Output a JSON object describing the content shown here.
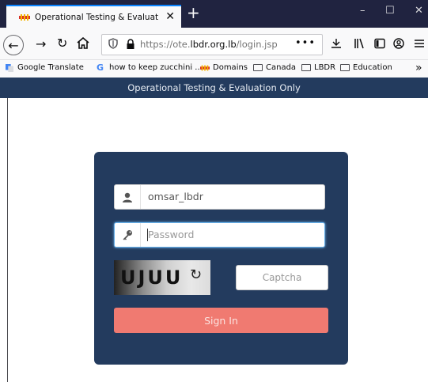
{
  "browser": {
    "tab": {
      "title": "Operational Testing & Evaluatic",
      "close": "✕"
    },
    "new_tab": "+",
    "window_controls": {
      "minimize": "–",
      "maximize": "☐",
      "close": "✕"
    },
    "url": {
      "prefix": "https://ote.",
      "domain": "lbdr.org.lb",
      "path": "/login.jsp"
    },
    "more": "•••",
    "bookmarks": [
      {
        "label": "Google Translate",
        "icon": "google-translate-icon"
      },
      {
        "label": "how to keep zucchini ...",
        "icon": "google-icon"
      },
      {
        "label": "Domains",
        "icon": "domains-favicon"
      },
      {
        "label": "Canada",
        "icon": "folder-icon"
      },
      {
        "label": "LBDR",
        "icon": "folder-icon"
      },
      {
        "label": "Education",
        "icon": "folder-icon"
      }
    ],
    "overflow": "»"
  },
  "page": {
    "banner": "Operational Testing & Evaluation Only",
    "login": {
      "username_value": "omsar_lbdr",
      "password_placeholder": "Password",
      "captcha_text": "UJUU",
      "captcha_placeholder": "Captcha",
      "signin_label": "Sign In"
    }
  },
  "colors": {
    "banner_bg": "#233b5e",
    "panel_bg": "#233b5e",
    "signin_bg": "#f07a71",
    "tab_accent": "#0a84ff"
  }
}
